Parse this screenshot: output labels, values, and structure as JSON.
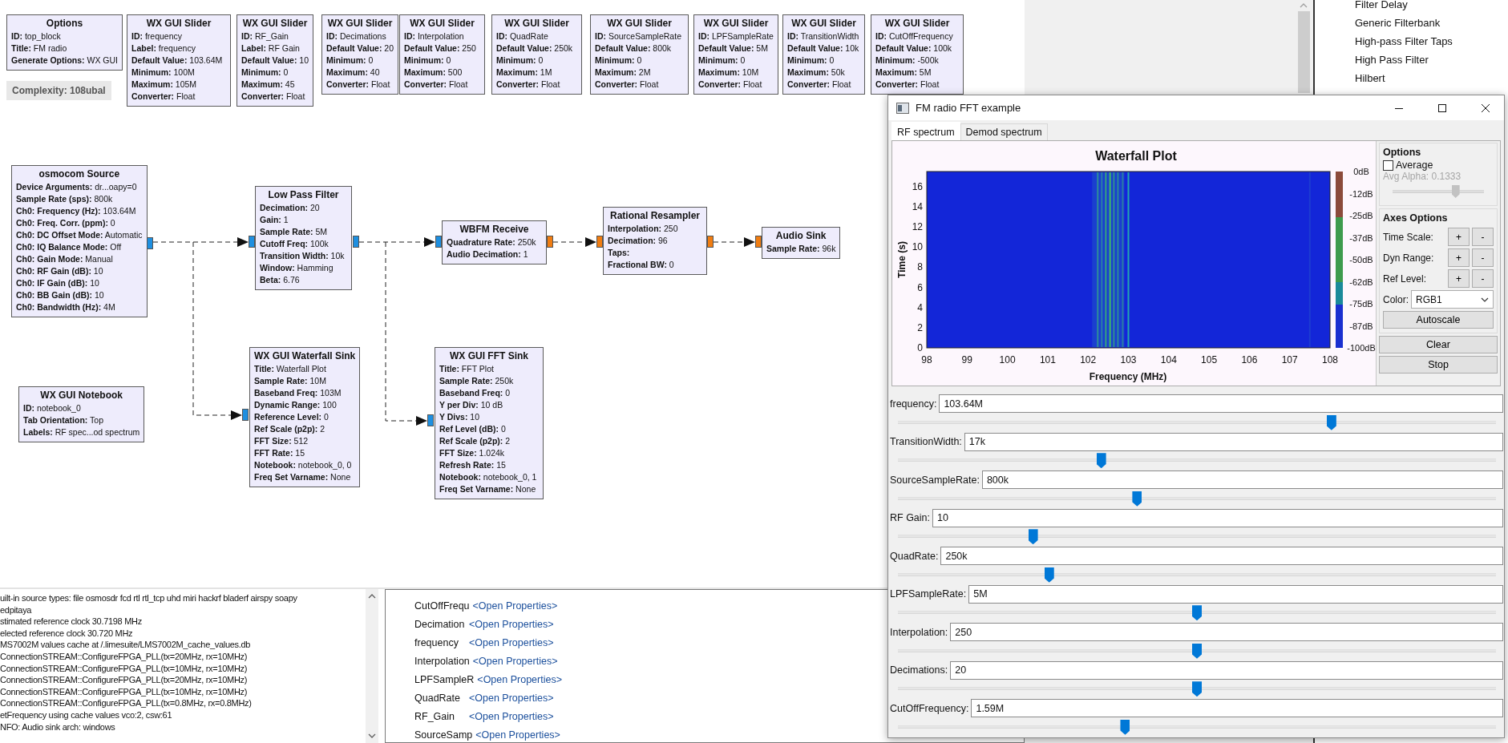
{
  "flowgraph": {
    "complexity": "Complexity: 108ubal",
    "blocks": [
      {
        "title": "Options",
        "params": [
          "**ID:** top_block",
          "**Title:** FM radio",
          "**Generate Options:** WX GUI"
        ]
      },
      {
        "title": "WX GUI Slider",
        "params": [
          "**ID:** frequency",
          "**Label:** frequency",
          "**Default Value:** 103.64M",
          "**Minimum:** 100M",
          "**Maximum:** 105M",
          "**Converter:** Float"
        ]
      },
      {
        "title": "WX GUI Slider",
        "params": [
          "**ID:** RF_Gain",
          "**Label:** RF Gain",
          "**Default Value:** 10",
          "**Minimum:** 0",
          "**Maximum:** 45",
          "**Converter:** Float"
        ]
      },
      {
        "title": "WX GUI Slider",
        "params": [
          "**ID:** Decimations",
          "**Default Value:** 20",
          "**Minimum:** 0",
          "**Maximum:** 40",
          "**Converter:** Float"
        ]
      },
      {
        "title": "WX GUI Slider",
        "params": [
          "**ID:** Interpolation",
          "**Default Value:** 250",
          "**Minimum:** 0",
          "**Maximum:** 500",
          "**Converter:** Float"
        ]
      },
      {
        "title": "WX GUI Slider",
        "params": [
          "**ID:** QuadRate",
          "**Default Value:** 250k",
          "**Minimum:** 0",
          "**Maximum:** 1M",
          "**Converter:** Float"
        ]
      },
      {
        "title": "WX GUI Slider",
        "params": [
          "**ID:** SourceSampleRate",
          "**Default Value:** 800k",
          "**Minimum:** 0",
          "**Maximum:** 2M",
          "**Converter:** Float"
        ]
      },
      {
        "title": "WX GUI Slider",
        "params": [
          "**ID:** LPFSampleRate",
          "**Default Value:** 5M",
          "**Minimum:** 0",
          "**Maximum:** 10M",
          "**Converter:** Float"
        ]
      },
      {
        "title": "WX GUI Slider",
        "params": [
          "**ID:** TransitionWidth",
          "**Default Value:** 10k",
          "**Minimum:** 0",
          "**Maximum:** 50k",
          "**Converter:** Float"
        ]
      },
      {
        "title": "WX GUI Slider",
        "params": [
          "**ID:** CutOffFrequency",
          "**Default Value:** 100k",
          "**Minimum:** -500k",
          "**Maximum:** 5M",
          "**Converter:** Float"
        ]
      },
      {
        "title": "osmocom Source",
        "params": [
          "**Device Arguments:** dr...oapy=0",
          "**Sample Rate (sps):** 800k",
          "**Ch0: Frequency (Hz):** 103.64M",
          "**Ch0: Freq. Corr. (ppm):** 0",
          "**Ch0: DC Offset Mode:** Automatic",
          "**Ch0: IQ Balance Mode:** Off",
          "**Ch0: Gain Mode:** Manual",
          "**Ch0: RF Gain (dB):** 10",
          "**Ch0: IF Gain (dB):** 10",
          "**Ch0: BB Gain (dB):** 10",
          "**Ch0: Bandwidth (Hz):** 4M"
        ]
      },
      {
        "title": "Low Pass Filter",
        "params": [
          "**Decimation:** 20",
          "**Gain:** 1",
          "**Sample Rate:** 5M",
          "**Cutoff Freq:** 100k",
          "**Transition Width:** 10k",
          "**Window:** Hamming",
          "**Beta:** 6.76"
        ]
      },
      {
        "title": "WBFM Receive",
        "params": [
          "**Quadrature Rate:** 250k",
          "**Audio Decimation:** 1"
        ]
      },
      {
        "title": "Rational Resampler",
        "params": [
          "**Interpolation:** 250",
          "**Decimation:** 96",
          "**Taps:**",
          "**Fractional BW:** 0"
        ]
      },
      {
        "title": "Audio Sink",
        "params": [
          "**Sample Rate:** 96k"
        ]
      },
      {
        "title": "WX GUI Notebook",
        "params": [
          "**ID:** notebook_0",
          "**Tab Orientation:** Top",
          "**Labels:** RF spec...od spectrum"
        ]
      },
      {
        "title": "WX GUI Waterfall Sink",
        "params": [
          "**Title:** Waterfall Plot",
          "**Sample Rate:** 10M",
          "**Baseband Freq:** 103M",
          "**Dynamic Range:** 100",
          "**Reference Level:** 0",
          "**Ref Scale (p2p):** 2",
          "**FFT Size:** 512",
          "**FFT Rate:** 15",
          "**Notebook:** notebook_0, 0",
          "**Freq Set Varname:** None"
        ]
      },
      {
        "title": "WX GUI FFT Sink",
        "params": [
          "**Title:** FFT Plot",
          "**Sample Rate:** 250k",
          "**Baseband Freq:** 0",
          "**Y per Div:** 10 dB",
          "**Y Divs:** 10",
          "**Ref Level (dB):** 0",
          "**Ref Scale (p2p):** 2",
          "**FFT Size:** 1.024k",
          "**Refresh Rate:** 15",
          "**Notebook:** notebook_0, 1",
          "**Freq Set Varname:** None"
        ]
      }
    ]
  },
  "block_library": {
    "items": [
      "Filter Delay",
      "Generic Filterbank",
      "High-pass Filter Taps",
      "High Pass Filter",
      "Hilbert"
    ]
  },
  "console": {
    "lines": [
      "uilt-in source types: file osmosdr fcd rtl rtl_tcp uhd miri hackrf bladerf airspy soapy",
      "edpitaya",
      "stimated reference clock 30.7198 MHz",
      "elected reference clock 30.720 MHz",
      "MS7002M values cache at /.limesuite/LMS7002M_cache_values.db",
      "ConnectionSTREAM::ConfigureFPGA_PLL(tx=20MHz, rx=10MHz)",
      "ConnectionSTREAM::ConfigureFPGA_PLL(tx=10MHz, rx=10MHz)",
      "ConnectionSTREAM::ConfigureFPGA_PLL(tx=20MHz, rx=10MHz)",
      "ConnectionSTREAM::ConfigureFPGA_PLL(tx=10MHz, rx=10MHz)",
      "ConnectionSTREAM::ConfigureFPGA_PLL(tx=0.8MHz, rx=0.8MHz)",
      "etFrequency using cache values vco:2, csw:61",
      "NFO: Audio sink arch: windows"
    ]
  },
  "variables": {
    "rows": [
      {
        "name": "CutOffFrequ",
        "value": "<Open Properties>"
      },
      {
        "name": "Decimation",
        "value": "<Open Properties>"
      },
      {
        "name": "frequency",
        "value": "<Open Properties>"
      },
      {
        "name": "Interpolation",
        "value": "<Open Properties>"
      },
      {
        "name": "LPFSampleR",
        "value": "<Open Properties>"
      },
      {
        "name": "QuadRate",
        "value": "<Open Properties>"
      },
      {
        "name": "RF_Gain",
        "value": "<Open Properties>"
      },
      {
        "name": "SourceSamp",
        "value": "<Open Properties>"
      }
    ]
  },
  "window": {
    "title": "FM radio FFT example",
    "tabs": [
      {
        "label": "RF spectrum",
        "selected": true
      },
      {
        "label": "Demod spectrum",
        "selected": false
      }
    ],
    "plot": {
      "title": "Waterfall Plot",
      "ylabel": "Time (s)",
      "xlabel": "Frequency (MHz)",
      "yticks": [
        "16",
        "14",
        "12",
        "10",
        "8",
        "6",
        "4",
        "2",
        "0"
      ],
      "xticks": [
        "98",
        "99",
        "100",
        "101",
        "102",
        "103",
        "104",
        "105",
        "106",
        "107",
        "108"
      ],
      "colorbar_labels": [
        "0dB",
        "-12dB",
        "-25dB",
        "-37dB",
        "-50dB",
        "-62dB",
        "-75dB",
        "-87dB",
        "-100dB"
      ]
    },
    "options": {
      "heading": "Options",
      "average": {
        "label": "Average",
        "checked": false
      },
      "avg_alpha": {
        "label": "Avg Alpha: 0.1333",
        "disabled": true,
        "level": 0.69
      },
      "axes_heading": "Axes Options",
      "axes_controls": [
        {
          "label": "Time Scale:",
          "plus": "+",
          "minus": "-"
        },
        {
          "label": "Dyn Range:",
          "plus": "+",
          "minus": "-"
        },
        {
          "label": "Ref Level:",
          "plus": "+",
          "minus": "-"
        }
      ],
      "color": {
        "label": "Color:",
        "value": "RGB1"
      },
      "autoscale": "Autoscale"
    },
    "buttons": [
      "Clear",
      "Stop"
    ],
    "sliders": [
      {
        "label": "frequency:",
        "value": "103.64M",
        "level": 0.725
      },
      {
        "label": "TransitionWidth:",
        "value": "17k",
        "level": 0.34
      },
      {
        "label": "SourceSampleRate:",
        "value": "800k",
        "level": 0.4
      },
      {
        "label": "RF Gain:",
        "value": "10",
        "level": 0.226
      },
      {
        "label": "QuadRate:",
        "value": "250k",
        "level": 0.253
      },
      {
        "label": "LPFSampleRate:",
        "value": "5M",
        "level": 0.5
      },
      {
        "label": "Interpolation:",
        "value": "250",
        "level": 0.5
      },
      {
        "label": "Decimations:",
        "value": "20",
        "level": 0.5
      },
      {
        "label": "CutOffFrequency:",
        "value": "1.59M",
        "level": 0.38
      }
    ]
  }
}
